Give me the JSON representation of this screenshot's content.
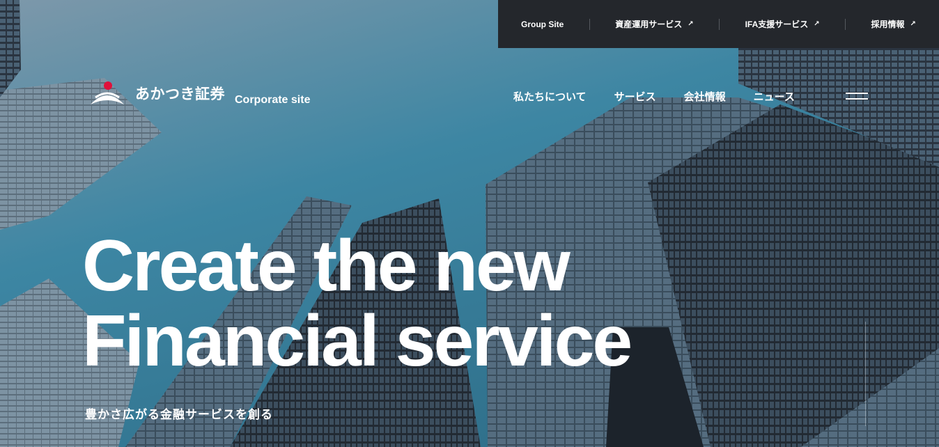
{
  "top_bar": {
    "items": [
      {
        "label": "Group Site",
        "external": false
      },
      {
        "label": "資産運用サービス",
        "external": true
      },
      {
        "label": "IFA支援サービス",
        "external": true
      },
      {
        "label": "採用情報",
        "external": true
      }
    ],
    "external_icon": "↗"
  },
  "logo": {
    "brand_name": "あかつき証券",
    "site_label": "Corporate site",
    "icon": "sunrise-logo-icon",
    "accent_color": "#e0103a"
  },
  "main_nav": {
    "items": [
      "私たちについて",
      "サービス",
      "会社情報",
      "ニュース"
    ],
    "menu_icon": "hamburger-menu-icon"
  },
  "hero": {
    "headline_line1": "Create the new",
    "headline_line2": "Financial service",
    "tagline": "豊かさ広がる金融サービスを創る",
    "background": "skyscrapers-photo"
  },
  "colors": {
    "topbar_bg": "#24272c",
    "sky": "#4a8aa5",
    "text": "#ffffff"
  }
}
